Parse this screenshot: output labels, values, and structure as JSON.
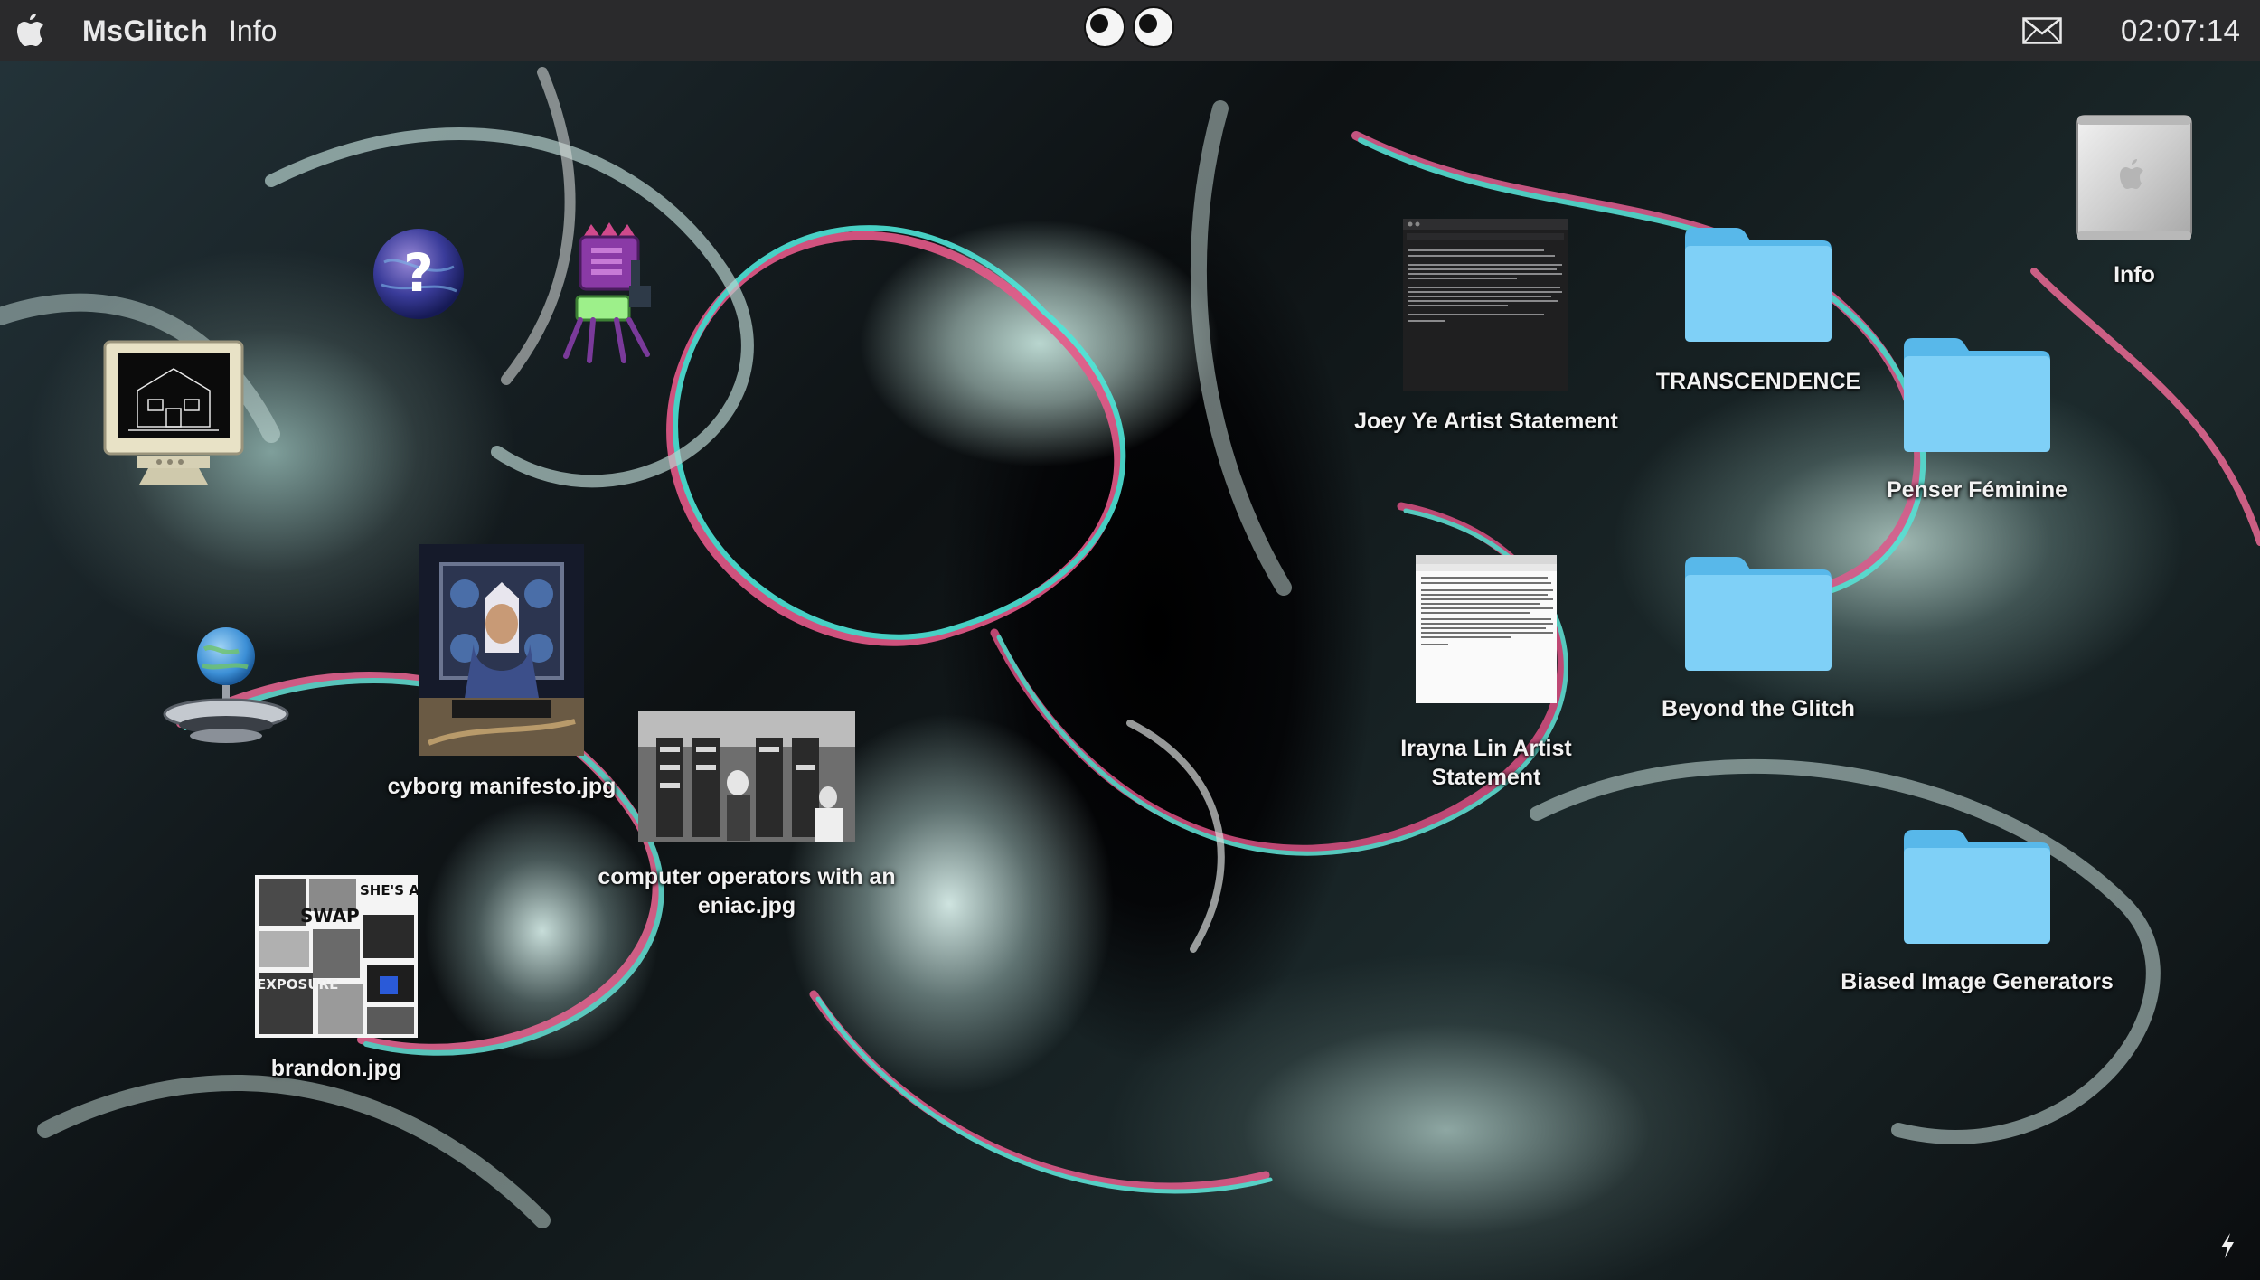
{
  "menubar": {
    "app_name": "MsGlitch",
    "menu_info": "Info",
    "clock": "02:07:14"
  },
  "desktop": {
    "documents": {
      "joey": "Joey Ye Artist Statement",
      "irayna": "Irayna Lin Artist Statement"
    },
    "folders": {
      "transcendence": "TRANSCENDENCE",
      "penser": "Penser Féminine",
      "beyond": "Beyond the Glitch",
      "biased": "Biased Image Generators"
    },
    "hd_label": "Info",
    "images": {
      "cyborg": "cyborg manifesto.jpg",
      "eniac": "computer operators with an eniac.jpg",
      "brandon": "brandon.jpg"
    },
    "brandon_collage_text": {
      "swap": "SWAP",
      "shes": "SHE'S A HE",
      "exposure": "EXPOSURE"
    }
  },
  "colors": {
    "menubar_bg": "#2a2a2c",
    "folder_blue": "#6cc6f3",
    "label_text": "#f2f2f2"
  },
  "icons": [
    "apple-icon",
    "googly-eyes-icon",
    "mail-icon",
    "help-globe-icon",
    "robot-icon",
    "retro-computer-icon",
    "globe-ufo-icon",
    "document-icon",
    "folder-icon",
    "hard-drive-icon",
    "lightning-icon"
  ]
}
